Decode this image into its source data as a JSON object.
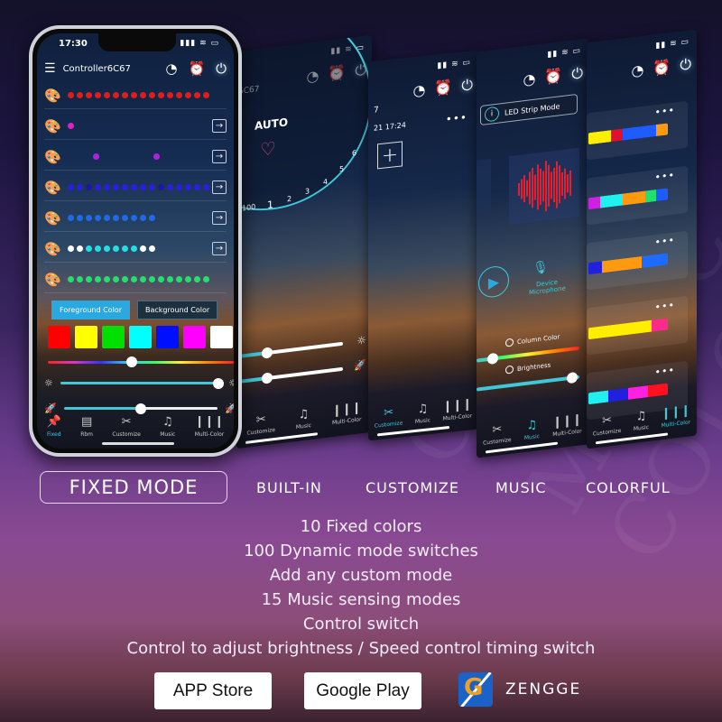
{
  "watermark": "MAGIC COLOR",
  "phone": {
    "status_time": "17:30",
    "status_icons": "▮▮▮ ≋ ▭",
    "menu_icon": "menu-icon",
    "controller_name": "Controller6C67",
    "header_icons": [
      "timer-icon",
      "alarm-icon",
      "power-icon"
    ],
    "mode_rows": [
      {
        "dots": [
          "#e31b1b",
          "#e31b1b",
          "#e31b1b",
          "#e31b1b",
          "#e31b1b",
          "#e31b1b",
          "#e31b1b",
          "#e31b1b",
          "#e31b1b",
          "#e31b1b",
          "#e31b1b",
          "#e31b1b",
          "#e31b1b",
          "#e31b1b",
          "#e31b1b",
          "#e31b1b"
        ],
        "has_arrow": false
      },
      {
        "dots": [
          "#e020c0"
        ],
        "has_arrow": true
      },
      {
        "dots": [
          "#b020e0",
          "#b020e0"
        ],
        "has_arrow": true
      },
      {
        "dots": [
          "#2a1ee0",
          "#2a1ee0",
          "#1a1aa0",
          "#2a1ee0",
          "#2a1ee0",
          "#2a1ee0",
          "#2a1ee0",
          "#2a1ee0",
          "#2a1ee0",
          "#2a1ee0",
          "#1a1aa0",
          "#2a1ee0",
          "#2a1ee0",
          "#2a1ee0",
          "#2a1ee0",
          "#2a1ee0"
        ],
        "has_arrow": true
      },
      {
        "dots": [
          "#1e6ae8",
          "#1e6ae8",
          "#1e6ae8",
          "#1e6ae8",
          "#1e6ae8",
          "#1e6ae8",
          "#1e6ae8",
          "#1e6ae8",
          "#1e6ae8",
          "#1e6ae8"
        ],
        "has_arrow": true
      },
      {
        "dots": [
          "#ffffff",
          "#ffffff",
          "#22e0e0",
          "#22e0e0",
          "#22e0e0",
          "#22e0e0",
          "#22e0e0",
          "#22e0e0",
          "#ffffff",
          "#ffffff"
        ],
        "has_arrow": true
      },
      {
        "dots": [
          "#22e070",
          "#22e070",
          "#22e070",
          "#22e070",
          "#22e070",
          "#22e070",
          "#22e070",
          "#22e070",
          "#22e070",
          "#22e070",
          "#22e070",
          "#22e070",
          "#22e070",
          "#22e070",
          "#22e070",
          "#22e070"
        ],
        "has_arrow": false
      }
    ],
    "foreground_tab": "Foreground Color",
    "background_tab": "Background Color",
    "swatches": [
      "#ff0000",
      "#ffff00",
      "#00e000",
      "#00ffff",
      "#0010ff",
      "#ff00ff",
      "#ffffff"
    ],
    "hue_slider_value": 0.45,
    "brightness_value": 0.98,
    "speed_value": 0.5,
    "tabs": [
      {
        "label": "Fixed",
        "icon": "pin-icon",
        "active": true
      },
      {
        "label": "Rbm",
        "icon": "save-icon",
        "active": false
      },
      {
        "label": "Customize",
        "icon": "customize-icon",
        "active": false
      },
      {
        "label": "Music",
        "icon": "music-icon",
        "active": false
      },
      {
        "label": "Multi-Color",
        "icon": "bars-icon",
        "active": false
      }
    ]
  },
  "builtin_screen": {
    "title_fragment": "6C67",
    "mode_label": "AUTO",
    "dial_numbers": [
      "100",
      "1",
      "2",
      "3",
      "4",
      "5",
      "6"
    ],
    "brightness_value": 0.2,
    "speed_value": 0.2,
    "tabs": [
      {
        "label": "Customize",
        "active": false
      },
      {
        "label": "Music",
        "active": false
      },
      {
        "label": "Multi-Color",
        "active": false
      }
    ]
  },
  "customize_screen": {
    "number_fragment": "7",
    "timestamp": "21 17:24",
    "add_button": "+",
    "tabs": [
      {
        "label": "Customize",
        "active": true
      },
      {
        "label": "Music",
        "active": false
      },
      {
        "label": "Multi-Color",
        "active": false
      }
    ]
  },
  "music_screen": {
    "mode_button": "LED Strip Mode",
    "source_label": "Device Microphone",
    "column_color_label": "Column Color",
    "brightness_label": "Brightness",
    "column_color_value": 0.1,
    "brightness_value": 0.95,
    "tabs": [
      {
        "label": "Customize",
        "active": false
      },
      {
        "label": "Music",
        "active": true
      },
      {
        "label": "Multi-Color",
        "active": false
      }
    ]
  },
  "colorful_screen": {
    "strips": [
      [
        "#ffee00",
        "#ffee00",
        "#e01030",
        "#1e5cff",
        "#1e5cff",
        "#1e5cff",
        "#ff9a10"
      ],
      [
        "#d020e0",
        "#20f0f0",
        "#20f0f0",
        "#ff9a10",
        "#ff9a10",
        "#20e070",
        "#1e5cff"
      ],
      [
        "#2020e0",
        "#ff9a10",
        "#ff9a10",
        "#ff9a10",
        "#1e6cff",
        "#1e6cff"
      ],
      [
        "#ffee00",
        "#ffee00",
        "#ffee00",
        "#ffee00",
        "#ff2a8a"
      ],
      [
        "#20f0f0",
        "#2020e0",
        "#ff20e0",
        "#ff1020"
      ]
    ],
    "more_label": "•••",
    "tabs": [
      {
        "label": "Customize",
        "active": false
      },
      {
        "label": "Music",
        "active": false
      },
      {
        "label": "Multi-Color",
        "active": true
      }
    ]
  },
  "modes": {
    "main": "FIXED MODE",
    "others": [
      "BUILT-IN",
      "CUSTOMIZE",
      "MUSIC",
      "COLORFUL"
    ]
  },
  "features": [
    "10 Fixed colors",
    "100 Dynamic mode switches",
    "Add any custom mode",
    "15 Music sensing modes",
    "Control switch",
    "Control to adjust brightness / Speed control timing switch"
  ],
  "downloads": {
    "app_store": "APP Store",
    "google_play": "Google Play"
  },
  "brand": {
    "name": "ZENGGE",
    "logo_letter": "G",
    "color": "#1a62c8",
    "accent": "#f0a020"
  },
  "colors": {
    "accent_cyan": "#3fc8d8",
    "tab_active": "#2aa8e0"
  }
}
